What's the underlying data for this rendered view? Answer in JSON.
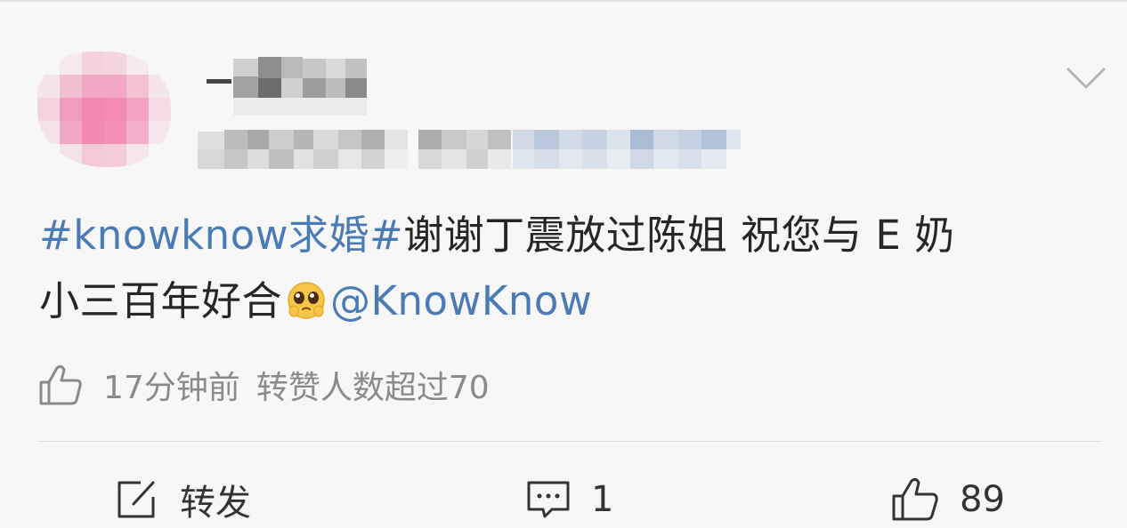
{
  "post": {
    "hashtag": "#knowknow求婚#",
    "text_line1": "谢谢丁震放过陈姐 祝您与 E 奶",
    "text_line2": "小三百年好合",
    "mention": "@KnowKnow",
    "emoji_icon": "pleading-face-emoji"
  },
  "meta": {
    "time": "17分钟前",
    "engagement": "转赞人数超过70"
  },
  "actions": {
    "repost_label": "转发",
    "comment_count": "1",
    "like_count": "89"
  },
  "colors": {
    "link": "#4a7bb5",
    "muted": "#8a8a8a",
    "background": "#f7f7f7"
  }
}
